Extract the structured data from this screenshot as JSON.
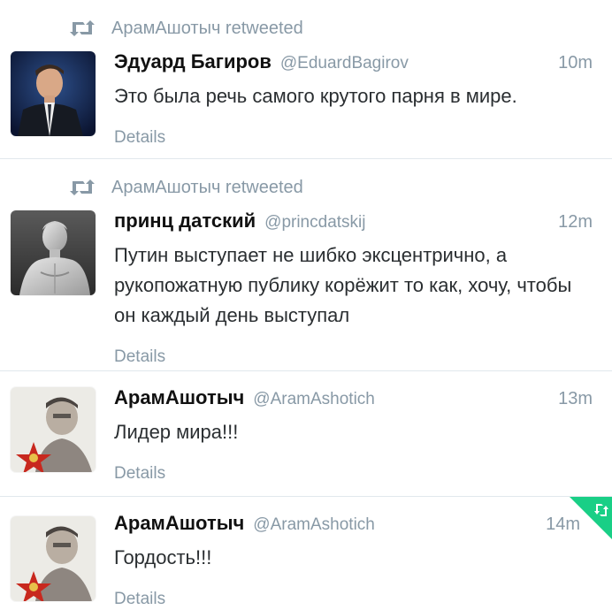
{
  "tweets": [
    {
      "retweeted_by": "АрамАшотыч retweeted",
      "fullname": "Эдуард Багиров",
      "username": "@EduardBagirov",
      "time": "10m",
      "text": "Это была речь самого крутого парня в мире.",
      "details_label": "Details",
      "avatar_icon": "avatar-man-in-suit"
    },
    {
      "retweeted_by": "АрамАшотыч retweeted",
      "fullname": "принц датский",
      "username": "@princdatskij",
      "time": "12m",
      "text": "Путин выступает не шибко эксцентрично, а рукопожатную публику корёжит то как, хочу, чтобы он каждый день выступал",
      "details_label": "Details",
      "avatar_icon": "avatar-statue"
    },
    {
      "fullname": "АрамАшотыч",
      "username": "@AramAshotich",
      "time": "13m",
      "text": "Лидер мира!!!",
      "details_label": "Details",
      "avatar_icon": "avatar-man-with-red-star"
    },
    {
      "fullname": "АрамАшотыч",
      "username": "@AramAshotich",
      "time": "14m",
      "text": "Гордость!!!",
      "details_label": "Details",
      "avatar_icon": "avatar-man-with-red-star"
    }
  ],
  "colors": {
    "meta_text": "#8899a6",
    "name_text": "#111111",
    "tweet_text": "#2a2e31",
    "divider": "#e1e8ed",
    "corner_badge": "#19cf86",
    "star_red": "#c8281e"
  },
  "icons": {
    "retweet": "retweet-icon",
    "corner_badge": "retweeted-corner-badge"
  }
}
